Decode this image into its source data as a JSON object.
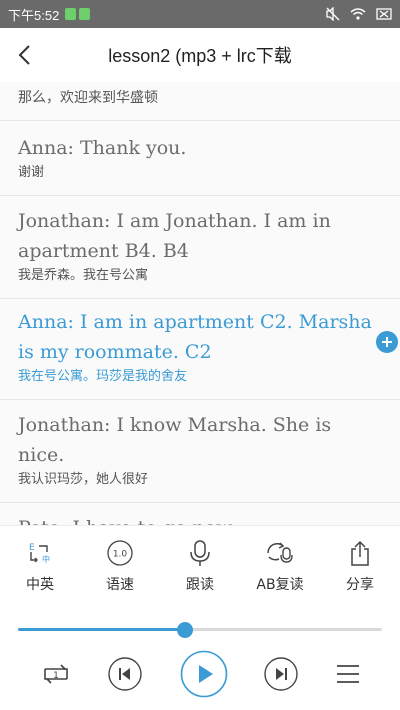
{
  "status_bar": {
    "time": "下午5:52"
  },
  "header": {
    "title": "lesson2 (mp3 + lrc下载"
  },
  "transcript": [
    {
      "en": "",
      "zh": "那么，欢迎来到华盛顿"
    },
    {
      "en": "Anna: Thank you.",
      "zh": "谢谢"
    },
    {
      "en": "Jonathan: I am Jonathan. I am in apartment B4. B4",
      "zh": "我是乔森。我在号公寓"
    },
    {
      "en": "Anna: I am in apartment C2. Marsha is my roommate. C2",
      "zh": "我在号公寓。玛莎是我的舍友"
    },
    {
      "en": "Jonathan: I know Marsha. She is nice.",
      "zh": "我认识玛莎，她人很好"
    },
    {
      "en": "Pete: I have to go now.",
      "zh": ""
    }
  ],
  "toolbar": {
    "items": [
      {
        "label": "中英",
        "icon": "translate-icon"
      },
      {
        "label": "语速",
        "icon": "speed-icon",
        "badge": "1.0"
      },
      {
        "label": "跟读",
        "icon": "microphone-icon"
      },
      {
        "label": "AB复读",
        "icon": "ab-repeat-icon"
      },
      {
        "label": "分享",
        "icon": "share-icon"
      }
    ]
  },
  "progress": {
    "fraction": 0.46
  },
  "player": {
    "repeat_count": "1"
  },
  "colors": {
    "accent": "#3a9bd5",
    "status_bar": "#6a6a6a"
  }
}
